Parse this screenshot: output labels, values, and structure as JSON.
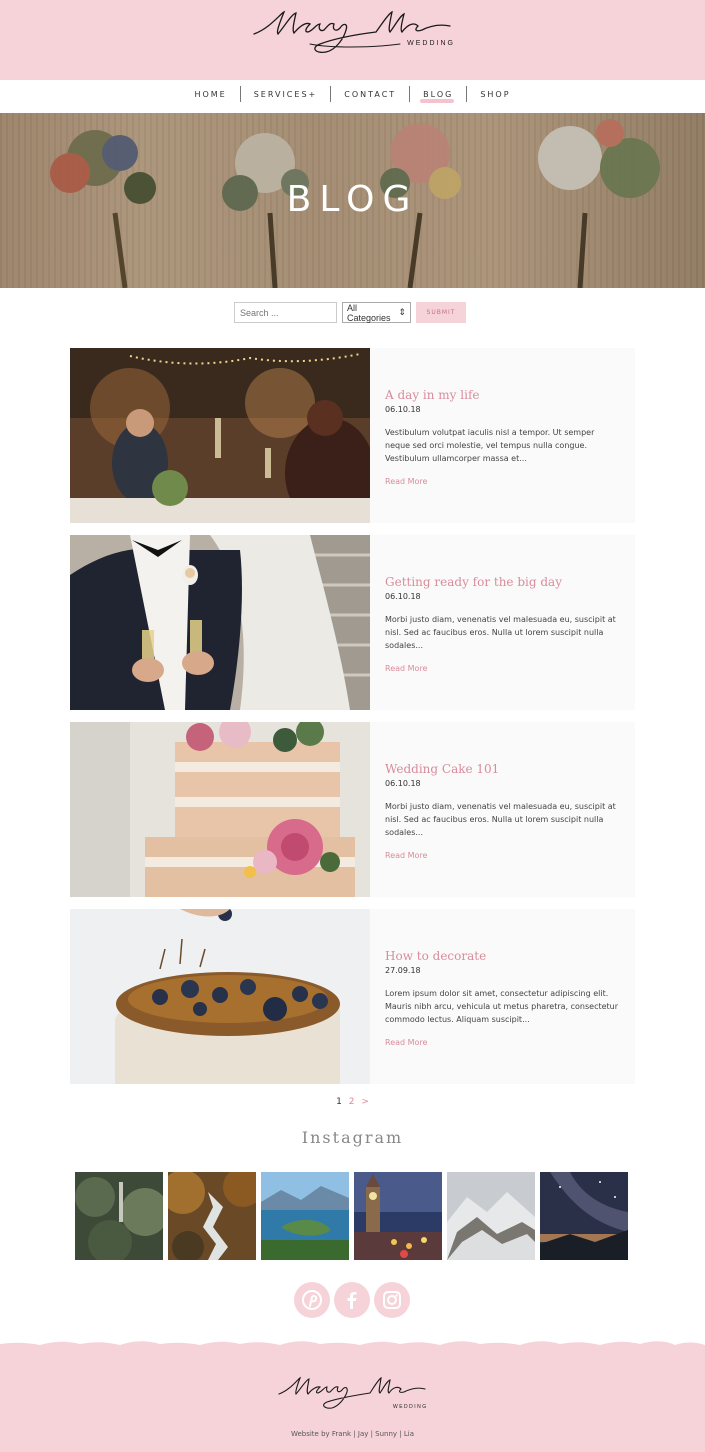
{
  "brand": {
    "name": "Merry Me",
    "sub": "WEDDING",
    "pink": "#f6d3d9",
    "accent": "#d98c9b"
  },
  "nav": {
    "items": [
      {
        "label": "HOME"
      },
      {
        "label": "SERVICES+"
      },
      {
        "label": "CONTACT"
      },
      {
        "label": "BLOG"
      },
      {
        "label": "SHOP"
      }
    ],
    "active": "BLOG"
  },
  "hero": {
    "title": "BLOG"
  },
  "search": {
    "placeholder": "Search ...",
    "category": "All Categories",
    "submit_label": "SUBMIT"
  },
  "posts": [
    {
      "title": "A day in my life",
      "date": "06.10.18",
      "excerpt": "Vestibulum volutpat iaculis nisl a tempor. Ut semper neque sed orci molestie, vel tempus nulla congue. Vestibulum ullamcorper massa et...",
      "more": "Read More",
      "image": "wedding-toast-photo"
    },
    {
      "title": "Getting ready for the big day",
      "date": "06.10.18",
      "excerpt": "Morbi justo diam, venenatis vel malesuada eu, suscipit at nisl. Sed ac faucibus eros. Nulla ut lorem suscipit nulla sodales...",
      "more": "Read More",
      "image": "groom-champagne-photo"
    },
    {
      "title": "Wedding Cake 101",
      "date": "06.10.18",
      "excerpt": "Morbi justo diam, venenatis vel malesuada eu, suscipit at nisl. Sed ac faucibus eros. Nulla ut lorem suscipit nulla sodales...",
      "more": "Read More",
      "image": "naked-cake-photo"
    },
    {
      "title": "How to decorate",
      "date": "27.09.18",
      "excerpt": "Lorem ipsum dolor sit amet, consectetur adipiscing elit. Mauris nibh arcu, vehicula ut metus pharetra, consectetur commodo lectus. Aliquam suscipit...",
      "more": "Read More",
      "image": "blueberry-cake-photo"
    }
  ],
  "pagination": {
    "current": "1",
    "next_page": "2",
    "next": ">"
  },
  "instagram": {
    "title": "Instagram",
    "tiles": [
      "forest-photo",
      "waterfall-photo",
      "lake-mountains-photo",
      "clock-tower-city-photo",
      "snowy-mountain-photo",
      "milky-way-photo"
    ]
  },
  "social": [
    "pinterest-icon",
    "facebook-icon",
    "instagram-icon"
  ],
  "footer": {
    "credit": "Website by Frank | Jay | Sunny | Lia"
  }
}
